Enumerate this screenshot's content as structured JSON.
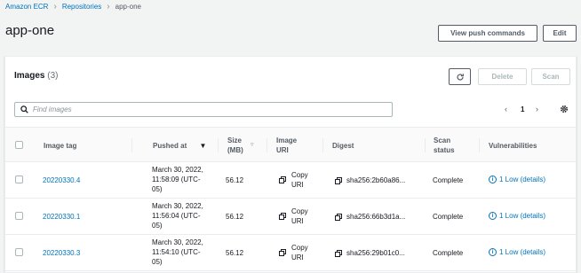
{
  "breadcrumb": {
    "items": [
      "Amazon ECR",
      "Repositories",
      "app-one"
    ]
  },
  "page": {
    "title": "app-one",
    "view_push_commands": "View push commands",
    "edit": "Edit"
  },
  "images": {
    "title": "Images",
    "count": "(3)",
    "delete": "Delete",
    "scan": "Scan",
    "search_placeholder": "Find images",
    "page_number": "1"
  },
  "table": {
    "columns": {
      "tag": "Image tag",
      "pushed": "Pushed at",
      "size": "Size (MB)",
      "uri": "Image URI",
      "digest": "Digest",
      "scan_status": "Scan status",
      "vuln": "Vulnerabilities"
    },
    "rows": [
      {
        "tag": "20220330.4",
        "pushed": "March 30, 2022, 11:58:09 (UTC-05)",
        "size": "56.12",
        "uri": "Copy URI",
        "digest": "sha256:2b60a86...",
        "scan_status": "Complete",
        "vuln": "1 Low (details)"
      },
      {
        "tag": "20220330.1",
        "pushed": "March 30, 2022, 11:56:04 (UTC-05)",
        "size": "56.12",
        "uri": "Copy URI",
        "digest": "sha256:66b3d1a...",
        "scan_status": "Complete",
        "vuln": "1 Low (details)"
      },
      {
        "tag": "20220330.3",
        "pushed": "March 30, 2022, 11:54:10 (UTC-05)",
        "size": "56.12",
        "uri": "Copy URI",
        "digest": "sha256:29b01c0...",
        "scan_status": "Complete",
        "vuln": "1 Low (details)"
      }
    ]
  },
  "icons": {
    "breadcrumb_separator": "chevron-right-icon",
    "refresh": "refresh-icon",
    "search": "search-icon",
    "prev": "chevron-left-icon",
    "next": "chevron-right-icon",
    "settings": "gear-icon",
    "sort": "caret-down-icon",
    "copy": "copy-icon",
    "info": "info-icon"
  },
  "colors": {
    "link": "#0073bb",
    "background": "#f2f3f3",
    "text": "#16191f"
  }
}
